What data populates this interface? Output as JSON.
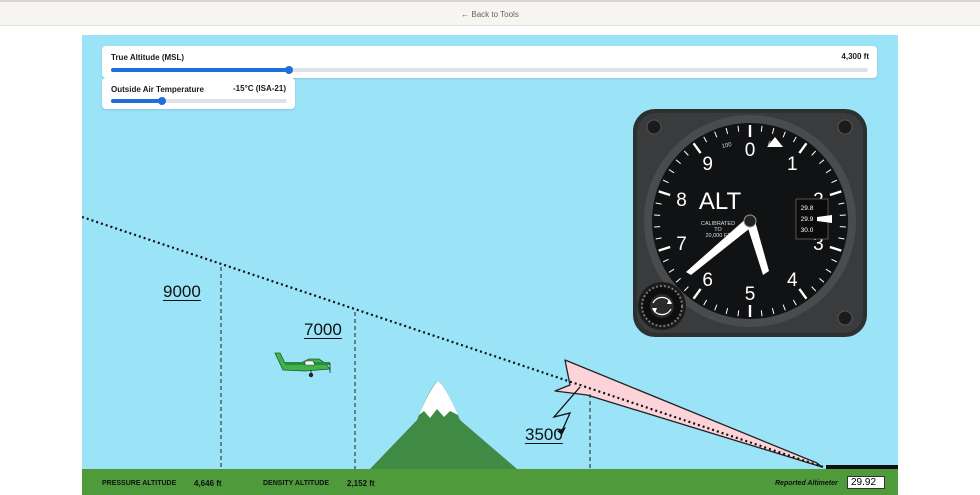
{
  "nav": {
    "back_label": "← Back to Tools"
  },
  "controls": {
    "true_altitude": {
      "label": "True Altitude (MSL)",
      "value": "4,300 ft",
      "fraction": 0.235
    },
    "oat": {
      "label": "Outside Air Temperature",
      "value": "-15°C (ISA-21)",
      "fraction": 0.29
    }
  },
  "scene_labels": {
    "alt_9000": "9000",
    "alt_7000": "7000",
    "alt_3500": "3500"
  },
  "altimeter": {
    "alt_text": "ALT",
    "calibrated": [
      "CALIBRATED",
      "TO",
      "20,000 FT"
    ],
    "digits": [
      "0",
      "1",
      "2",
      "3",
      "4",
      "5",
      "6",
      "7",
      "8",
      "9"
    ],
    "small_100": "100",
    "small_ft": "FT",
    "kollsman": [
      "29.8",
      "29.9",
      "30.0"
    ]
  },
  "footer": {
    "pressure_altitude_label": "PRESSURE ALTITUDE",
    "pressure_altitude_value": "4,646 ft",
    "density_altitude_label": "DENSITY ALTITUDE",
    "density_altitude_value": "2,152 ft",
    "reported_altimeter_label": "Reported Altimeter",
    "reported_altimeter_value": "29.92"
  },
  "colors": {
    "sky": "#9be3f7",
    "ground": "#4f9b3c",
    "accent": "#1e6fd9",
    "mountain": "#3f8a45",
    "plane": "#3fb44d",
    "warning_fill": "#fbd3d8"
  }
}
